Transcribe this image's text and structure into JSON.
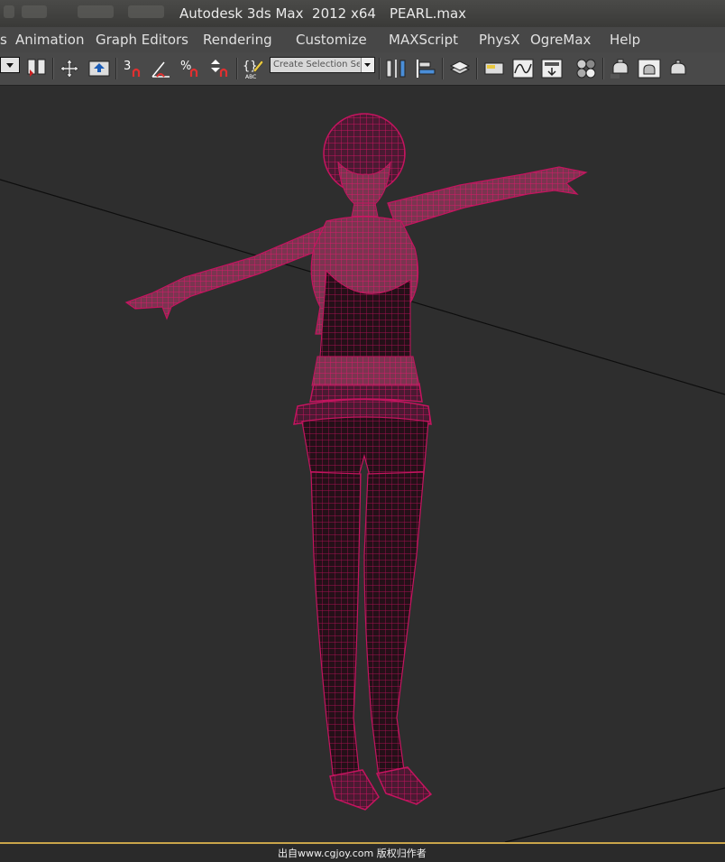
{
  "window": {
    "title": "Autodesk 3ds Max  2012 x64",
    "file": "PEARL.max"
  },
  "menu": {
    "items": [
      {
        "label": "s"
      },
      {
        "label": "Animation"
      },
      {
        "label": "Graph Editors"
      },
      {
        "label": "Rendering"
      },
      {
        "label": "Customize"
      },
      {
        "label": "MAXScript"
      },
      {
        "label": "PhysX"
      },
      {
        "label": "OgreMax"
      },
      {
        "label": "Help"
      }
    ]
  },
  "toolbar": {
    "selection_set_placeholder": "Create Selection Se",
    "snap_3d_label": "3",
    "percent_snap_label": "%",
    "icons": [
      "selection-filter-dropdown",
      "select-and-link-icon",
      "select-and-move-icon",
      "viewport-extract-icon",
      "snaps-toggle-icon",
      "angle-snap-icon",
      "percent-snap-icon",
      "spinner-snap-icon",
      "edit-named-selection-icon",
      "mirror-icon",
      "align-icon",
      "layer-manager-icon",
      "graphite-modeling-icon",
      "curve-editor-icon",
      "schematic-view-icon",
      "material-editor-icon",
      "render-setup-icon",
      "rendered-frame-window-icon",
      "render-production-icon",
      "render-iterative-icon"
    ]
  },
  "viewport": {
    "wire_color": "#b0105a",
    "background": "#2e2e2e",
    "grid_line_color": "#0e0e0e"
  },
  "status": {
    "watermark": "出自www.cgjoy.com 版权归作者"
  }
}
